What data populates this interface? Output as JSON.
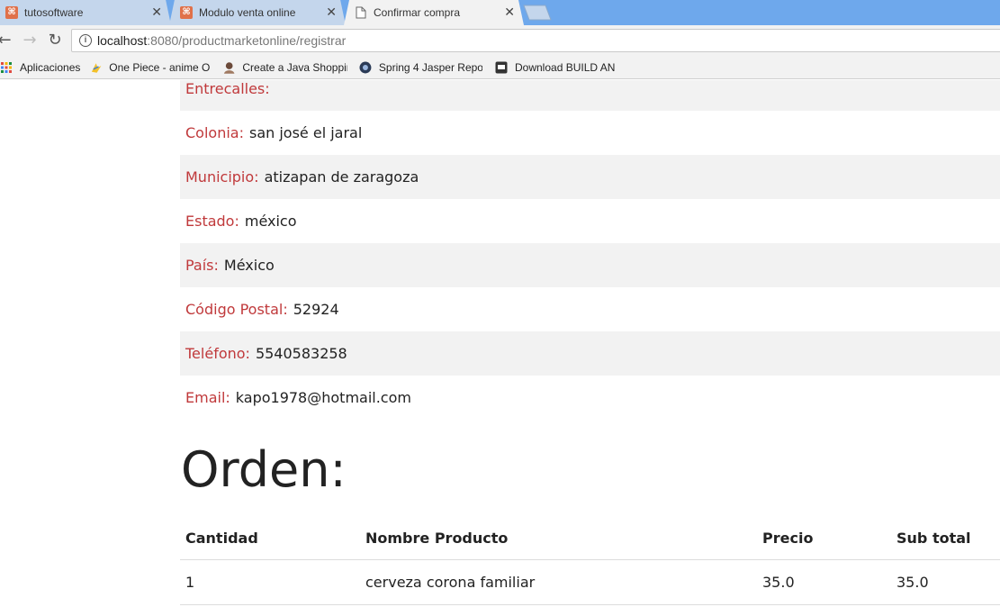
{
  "browser": {
    "tabs": [
      {
        "title": "tutosoftware",
        "active": false,
        "favicon": "xampp-icon"
      },
      {
        "title": "Modulo venta online",
        "active": false,
        "favicon": "xampp-icon"
      },
      {
        "title": "Confirmar compra",
        "active": true,
        "favicon": "document-icon"
      }
    ],
    "url_host": "localhost",
    "url_path": ":8080/productmarketonline/registrar",
    "bookmarks": [
      {
        "label": "Aplicaciones",
        "icon": "apps-grid-icon"
      },
      {
        "label": "One Piece - anime On",
        "icon": "anime-icon"
      },
      {
        "label": "Create a Java Shoppin",
        "icon": "avatar-icon"
      },
      {
        "label": "Spring 4 Jasper Repo",
        "icon": "disc-icon"
      },
      {
        "label": "Download BUILD AN",
        "icon": "download-icon"
      }
    ]
  },
  "address": {
    "fields": [
      {
        "label": "Entrecalles:",
        "value": ""
      },
      {
        "label": "Colonia:",
        "value": "san josé el jaral"
      },
      {
        "label": "Municipio:",
        "value": "atizapan de zaragoza"
      },
      {
        "label": "Estado:",
        "value": "méxico"
      },
      {
        "label": "País:",
        "value": "México"
      },
      {
        "label": "Código Postal:",
        "value": "52924"
      },
      {
        "label": "Teléfono:",
        "value": "5540583258"
      },
      {
        "label": "Email:",
        "value": "kapo1978@hotmail.com"
      }
    ]
  },
  "order": {
    "title": "Orden:",
    "headers": [
      "Cantidad",
      "Nombre Producto",
      "Precio",
      "Sub total"
    ],
    "rows": [
      [
        "1",
        "cerveza corona familiar",
        "35.0",
        "35.0"
      ]
    ]
  },
  "colors": {
    "label_red": "#c0393b",
    "tab_strip": "#6ea8ec"
  }
}
